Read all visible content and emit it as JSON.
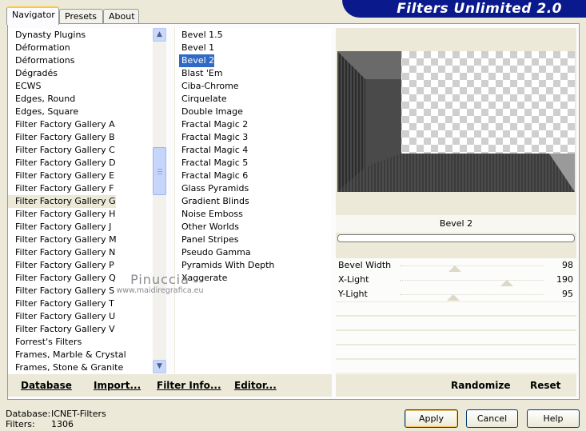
{
  "tabs": [
    {
      "label": "Navigator",
      "active": true
    },
    {
      "label": "Presets",
      "active": false
    },
    {
      "label": "About",
      "active": false
    }
  ],
  "banner": {
    "title": "Filters Unlimited 2.0"
  },
  "categories": {
    "items": [
      "Dynasty Plugins",
      "Déformation",
      "Déformations",
      "Dégradés",
      "ECWS",
      "Edges, Round",
      "Edges, Square",
      "Filter Factory Gallery A",
      "Filter Factory Gallery B",
      "Filter Factory Gallery C",
      "Filter Factory Gallery D",
      "Filter Factory Gallery E",
      "Filter Factory Gallery F",
      "Filter Factory Gallery G",
      "Filter Factory Gallery H",
      "Filter Factory Gallery J",
      "Filter Factory Gallery M",
      "Filter Factory Gallery N",
      "Filter Factory Gallery P",
      "Filter Factory Gallery Q",
      "Filter Factory Gallery S",
      "Filter Factory Gallery T",
      "Filter Factory Gallery U",
      "Filter Factory Gallery V",
      "Forrest's Filters",
      "Frames, Marble & Crystal",
      "Frames, Stone & Granite"
    ],
    "selected": "Filter Factory Gallery G"
  },
  "filters": {
    "items": [
      "Bevel 1.5",
      "Bevel 1",
      "Bevel 2",
      "Blast 'Em",
      "Ciba-Chrome",
      "Cirquelate",
      "Double Image",
      "Fractal Magic 2",
      "Fractal Magic 3",
      "Fractal Magic 4",
      "Fractal Magic 5",
      "Fractal Magic 6",
      "Glass Pyramids",
      "Gradient Blinds",
      "Noise Emboss",
      "Other Worlds",
      "Panel Stripes",
      "Pseudo Gamma",
      "Pyramids With Depth",
      "Xaggerate"
    ],
    "selected": "Bevel 2"
  },
  "preview": {
    "filter_name": "Bevel 2"
  },
  "sliders": [
    {
      "label": "Bevel Width",
      "value": "98",
      "level": 98
    },
    {
      "label": "X-Light",
      "value": "190",
      "level": 190
    },
    {
      "label": "Y-Light",
      "value": "95",
      "level": 95
    }
  ],
  "watermark": {
    "name": "Pinuccia",
    "url": "www.maidiregrafica.eu"
  },
  "actions": {
    "database": "Database",
    "import": "Import...",
    "filter_info": "Filter Info...",
    "editor": "Editor...",
    "randomize": "Randomize",
    "reset": "Reset"
  },
  "status": {
    "database_label": "Database:",
    "database_value": "ICNET-Filters",
    "filters_label": "Filters:",
    "filters_value": "1306"
  },
  "buttons": {
    "apply": "Apply",
    "cancel": "Cancel",
    "help": "Help"
  }
}
